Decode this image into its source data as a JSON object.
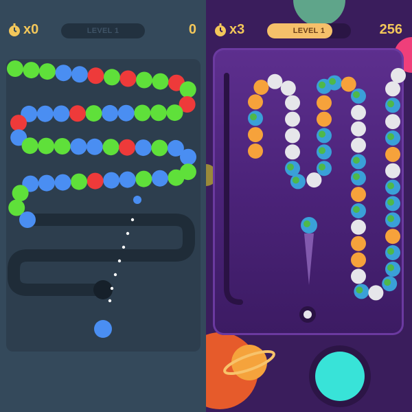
{
  "left_game": {
    "combo_label": "x0",
    "level_label": "LEVEL 1",
    "score": "0",
    "colors": {
      "green": "#5fe03a",
      "blue": "#4a8ef2",
      "red": "#ee3a3a"
    },
    "chain": [
      "green",
      "green",
      "green",
      "blue",
      "blue",
      "red",
      "green",
      "red",
      "green",
      "green",
      "red",
      "green",
      "red",
      "green",
      "green",
      "green",
      "blue",
      "blue",
      "green",
      "red",
      "blue",
      "blue",
      "blue",
      "red",
      "blue",
      "green",
      "green",
      "green",
      "blue",
      "blue",
      "green",
      "red",
      "blue",
      "green",
      "blue",
      "blue",
      "green",
      "green",
      "blue",
      "green",
      "blue",
      "blue",
      "red",
      "green",
      "blue",
      "blue",
      "blue",
      "green",
      "green",
      "blue"
    ],
    "shooter_ball": "blue",
    "next_ball": "blue"
  },
  "right_game": {
    "combo_label": "x3",
    "level_label": "LEVEL 1",
    "score": "256",
    "level_progress": 0.78,
    "colors": {
      "orange": "#f6a23b",
      "white": "#e6e6ea",
      "earth": "#3aa0d8",
      "earth_land": "#4fb84a"
    },
    "chain": [
      "orange",
      "orange",
      "earth",
      "orange",
      "orange",
      "white",
      "white",
      "white",
      "white",
      "white",
      "white",
      "earth",
      "earth",
      "white",
      "earth",
      "earth",
      "earth",
      "orange",
      "orange",
      "earth",
      "earth",
      "orange",
      "earth",
      "white",
      "white",
      "white",
      "earth",
      "earth",
      "orange",
      "earth",
      "white",
      "orange",
      "orange",
      "white",
      "earth",
      "white",
      "earth",
      "earth",
      "earth",
      "orange",
      "earth",
      "earth",
      "earth",
      "white",
      "orange",
      "earth",
      "white",
      "earth",
      "white",
      "white"
    ],
    "shooter_ball": "earth",
    "next_ball": "white"
  }
}
